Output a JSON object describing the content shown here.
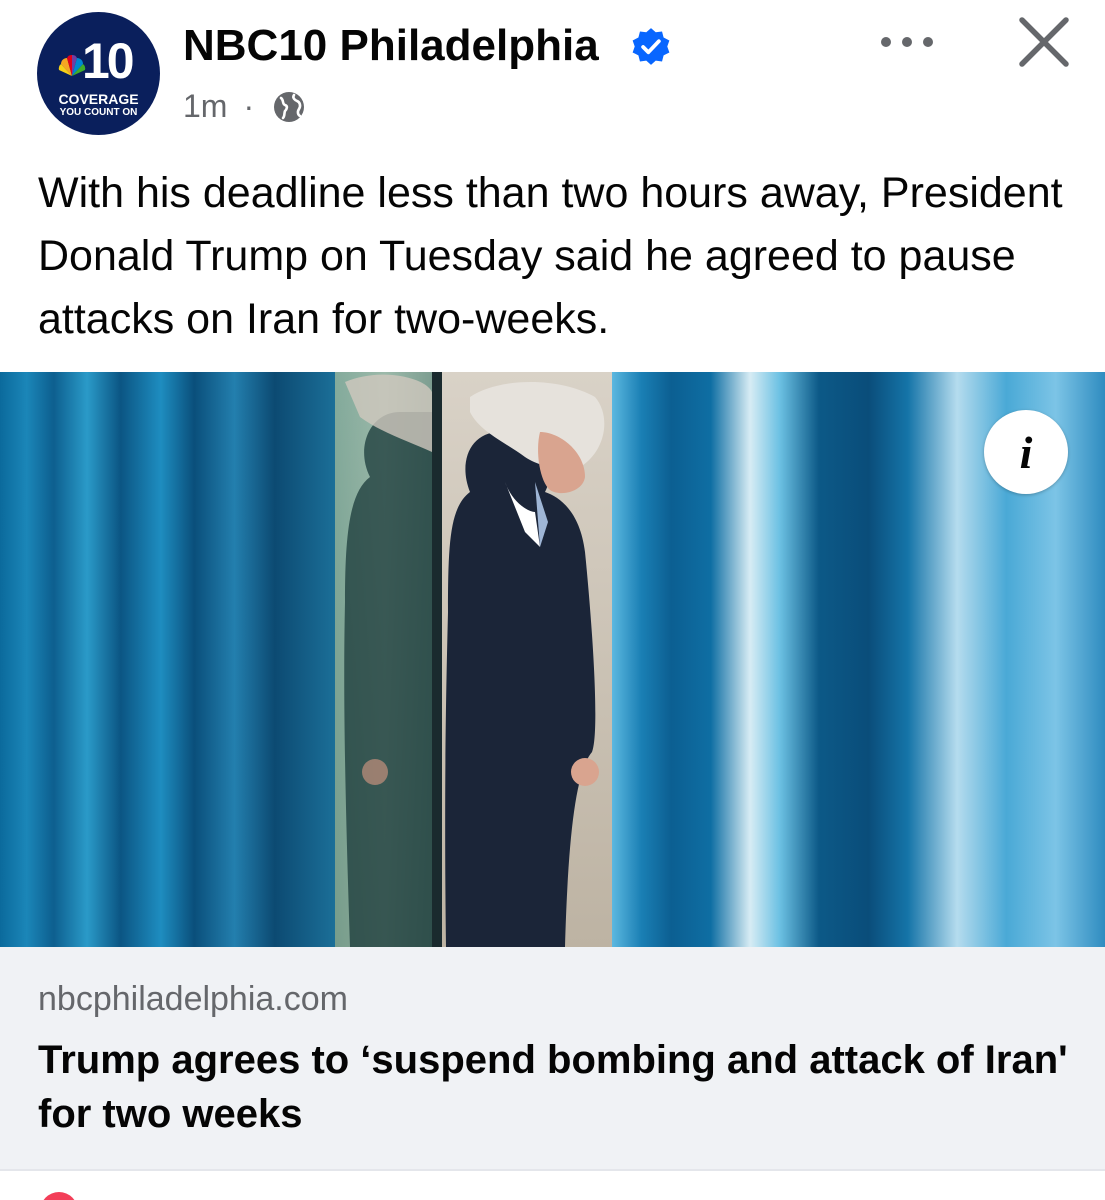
{
  "page": {
    "name": "NBC10 Philadelphia",
    "avatar": {
      "number": "10",
      "line1": "COVERAGE",
      "line2": "YOU COUNT ON"
    },
    "verified": true,
    "time": "1m",
    "separator": "·",
    "audience_icon": "globe-icon"
  },
  "actions": {
    "more_icon": "more-options-icon",
    "close_icon": "close-icon"
  },
  "post": {
    "text": "With his deadline less than two hours away, President Donald Trump on Tuesday said he agreed to pause attacks on Iran for two-weeks."
  },
  "image": {
    "info_label": "i"
  },
  "link": {
    "domain": "nbcphiladelphia.com",
    "title": "Trump agrees to ‘suspend bombing and attack of Iran' for two weeks"
  },
  "colors": {
    "verified": "#0866ff",
    "secondary_text": "#65676b",
    "card_bg": "#f0f2f5",
    "avatar_bg": "#0a1f5c"
  }
}
